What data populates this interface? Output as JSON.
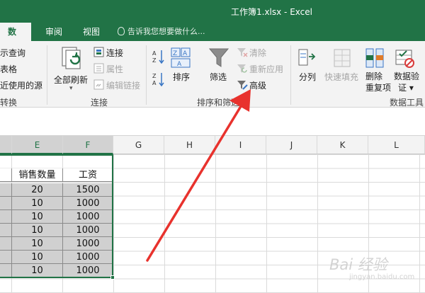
{
  "window": {
    "title": "工作簿1.xlsx - Excel"
  },
  "tabs": [
    "数据",
    "审阅",
    "视图"
  ],
  "tell_me": {
    "placeholder": "告诉我您想要做什么..."
  },
  "groups": {
    "get_transform": {
      "items": [
        "示查询",
        "表格",
        "近使用的源"
      ],
      "label": "转换"
    },
    "connections": {
      "refresh_all": "全部刷新",
      "connections": "连接",
      "properties": "属性",
      "edit_links": "编辑链接",
      "label": "连接"
    },
    "sort_filter": {
      "sort": "排序",
      "filter": "筛选",
      "clear": "清除",
      "reapply": "重新应用",
      "advanced": "高级",
      "label": "排序和筛选"
    },
    "data_tools": {
      "text_to_columns": "分列",
      "flash_fill": "快速填充",
      "remove_duplicates": "删除重复项",
      "data_validation": "数据验证",
      "label": "数据工具"
    }
  },
  "columns": [
    "E",
    "F",
    "G",
    "H",
    "I",
    "J",
    "K",
    "L"
  ],
  "table": {
    "headers": [
      "销售数量",
      "工资"
    ],
    "rows": [
      [
        "20",
        "1500"
      ],
      [
        "10",
        "1000"
      ],
      [
        "10",
        "1000"
      ],
      [
        "10",
        "1000"
      ],
      [
        "10",
        "1000"
      ],
      [
        "10",
        "1000"
      ],
      [
        "10",
        "1000"
      ]
    ]
  },
  "watermark": {
    "brand": "Bai 经验",
    "url": "jingyan.baidu.com"
  },
  "colors": {
    "excel_green": "#217346",
    "arrow_red": "#e8322d",
    "selected_fill": "#d0d0d0"
  }
}
